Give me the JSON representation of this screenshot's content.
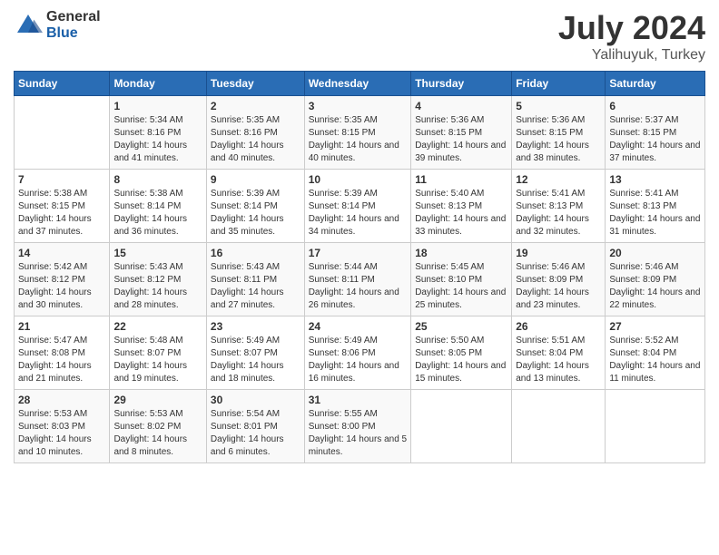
{
  "logo": {
    "general": "General",
    "blue": "Blue"
  },
  "title": "July 2024",
  "subtitle": "Yalihuyuk, Turkey",
  "header_days": [
    "Sunday",
    "Monday",
    "Tuesday",
    "Wednesday",
    "Thursday",
    "Friday",
    "Saturday"
  ],
  "weeks": [
    [
      {
        "num": "",
        "sunrise": "",
        "sunset": "",
        "daylight": ""
      },
      {
        "num": "1",
        "sunrise": "Sunrise: 5:34 AM",
        "sunset": "Sunset: 8:16 PM",
        "daylight": "Daylight: 14 hours and 41 minutes."
      },
      {
        "num": "2",
        "sunrise": "Sunrise: 5:35 AM",
        "sunset": "Sunset: 8:16 PM",
        "daylight": "Daylight: 14 hours and 40 minutes."
      },
      {
        "num": "3",
        "sunrise": "Sunrise: 5:35 AM",
        "sunset": "Sunset: 8:15 PM",
        "daylight": "Daylight: 14 hours and 40 minutes."
      },
      {
        "num": "4",
        "sunrise": "Sunrise: 5:36 AM",
        "sunset": "Sunset: 8:15 PM",
        "daylight": "Daylight: 14 hours and 39 minutes."
      },
      {
        "num": "5",
        "sunrise": "Sunrise: 5:36 AM",
        "sunset": "Sunset: 8:15 PM",
        "daylight": "Daylight: 14 hours and 38 minutes."
      },
      {
        "num": "6",
        "sunrise": "Sunrise: 5:37 AM",
        "sunset": "Sunset: 8:15 PM",
        "daylight": "Daylight: 14 hours and 37 minutes."
      }
    ],
    [
      {
        "num": "7",
        "sunrise": "Sunrise: 5:38 AM",
        "sunset": "Sunset: 8:15 PM",
        "daylight": "Daylight: 14 hours and 37 minutes."
      },
      {
        "num": "8",
        "sunrise": "Sunrise: 5:38 AM",
        "sunset": "Sunset: 8:14 PM",
        "daylight": "Daylight: 14 hours and 36 minutes."
      },
      {
        "num": "9",
        "sunrise": "Sunrise: 5:39 AM",
        "sunset": "Sunset: 8:14 PM",
        "daylight": "Daylight: 14 hours and 35 minutes."
      },
      {
        "num": "10",
        "sunrise": "Sunrise: 5:39 AM",
        "sunset": "Sunset: 8:14 PM",
        "daylight": "Daylight: 14 hours and 34 minutes."
      },
      {
        "num": "11",
        "sunrise": "Sunrise: 5:40 AM",
        "sunset": "Sunset: 8:13 PM",
        "daylight": "Daylight: 14 hours and 33 minutes."
      },
      {
        "num": "12",
        "sunrise": "Sunrise: 5:41 AM",
        "sunset": "Sunset: 8:13 PM",
        "daylight": "Daylight: 14 hours and 32 minutes."
      },
      {
        "num": "13",
        "sunrise": "Sunrise: 5:41 AM",
        "sunset": "Sunset: 8:13 PM",
        "daylight": "Daylight: 14 hours and 31 minutes."
      }
    ],
    [
      {
        "num": "14",
        "sunrise": "Sunrise: 5:42 AM",
        "sunset": "Sunset: 8:12 PM",
        "daylight": "Daylight: 14 hours and 30 minutes."
      },
      {
        "num": "15",
        "sunrise": "Sunrise: 5:43 AM",
        "sunset": "Sunset: 8:12 PM",
        "daylight": "Daylight: 14 hours and 28 minutes."
      },
      {
        "num": "16",
        "sunrise": "Sunrise: 5:43 AM",
        "sunset": "Sunset: 8:11 PM",
        "daylight": "Daylight: 14 hours and 27 minutes."
      },
      {
        "num": "17",
        "sunrise": "Sunrise: 5:44 AM",
        "sunset": "Sunset: 8:11 PM",
        "daylight": "Daylight: 14 hours and 26 minutes."
      },
      {
        "num": "18",
        "sunrise": "Sunrise: 5:45 AM",
        "sunset": "Sunset: 8:10 PM",
        "daylight": "Daylight: 14 hours and 25 minutes."
      },
      {
        "num": "19",
        "sunrise": "Sunrise: 5:46 AM",
        "sunset": "Sunset: 8:09 PM",
        "daylight": "Daylight: 14 hours and 23 minutes."
      },
      {
        "num": "20",
        "sunrise": "Sunrise: 5:46 AM",
        "sunset": "Sunset: 8:09 PM",
        "daylight": "Daylight: 14 hours and 22 minutes."
      }
    ],
    [
      {
        "num": "21",
        "sunrise": "Sunrise: 5:47 AM",
        "sunset": "Sunset: 8:08 PM",
        "daylight": "Daylight: 14 hours and 21 minutes."
      },
      {
        "num": "22",
        "sunrise": "Sunrise: 5:48 AM",
        "sunset": "Sunset: 8:07 PM",
        "daylight": "Daylight: 14 hours and 19 minutes."
      },
      {
        "num": "23",
        "sunrise": "Sunrise: 5:49 AM",
        "sunset": "Sunset: 8:07 PM",
        "daylight": "Daylight: 14 hours and 18 minutes."
      },
      {
        "num": "24",
        "sunrise": "Sunrise: 5:49 AM",
        "sunset": "Sunset: 8:06 PM",
        "daylight": "Daylight: 14 hours and 16 minutes."
      },
      {
        "num": "25",
        "sunrise": "Sunrise: 5:50 AM",
        "sunset": "Sunset: 8:05 PM",
        "daylight": "Daylight: 14 hours and 15 minutes."
      },
      {
        "num": "26",
        "sunrise": "Sunrise: 5:51 AM",
        "sunset": "Sunset: 8:04 PM",
        "daylight": "Daylight: 14 hours and 13 minutes."
      },
      {
        "num": "27",
        "sunrise": "Sunrise: 5:52 AM",
        "sunset": "Sunset: 8:04 PM",
        "daylight": "Daylight: 14 hours and 11 minutes."
      }
    ],
    [
      {
        "num": "28",
        "sunrise": "Sunrise: 5:53 AM",
        "sunset": "Sunset: 8:03 PM",
        "daylight": "Daylight: 14 hours and 10 minutes."
      },
      {
        "num": "29",
        "sunrise": "Sunrise: 5:53 AM",
        "sunset": "Sunset: 8:02 PM",
        "daylight": "Daylight: 14 hours and 8 minutes."
      },
      {
        "num": "30",
        "sunrise": "Sunrise: 5:54 AM",
        "sunset": "Sunset: 8:01 PM",
        "daylight": "Daylight: 14 hours and 6 minutes."
      },
      {
        "num": "31",
        "sunrise": "Sunrise: 5:55 AM",
        "sunset": "Sunset: 8:00 PM",
        "daylight": "Daylight: 14 hours and 5 minutes."
      },
      {
        "num": "",
        "sunrise": "",
        "sunset": "",
        "daylight": ""
      },
      {
        "num": "",
        "sunrise": "",
        "sunset": "",
        "daylight": ""
      },
      {
        "num": "",
        "sunrise": "",
        "sunset": "",
        "daylight": ""
      }
    ]
  ]
}
